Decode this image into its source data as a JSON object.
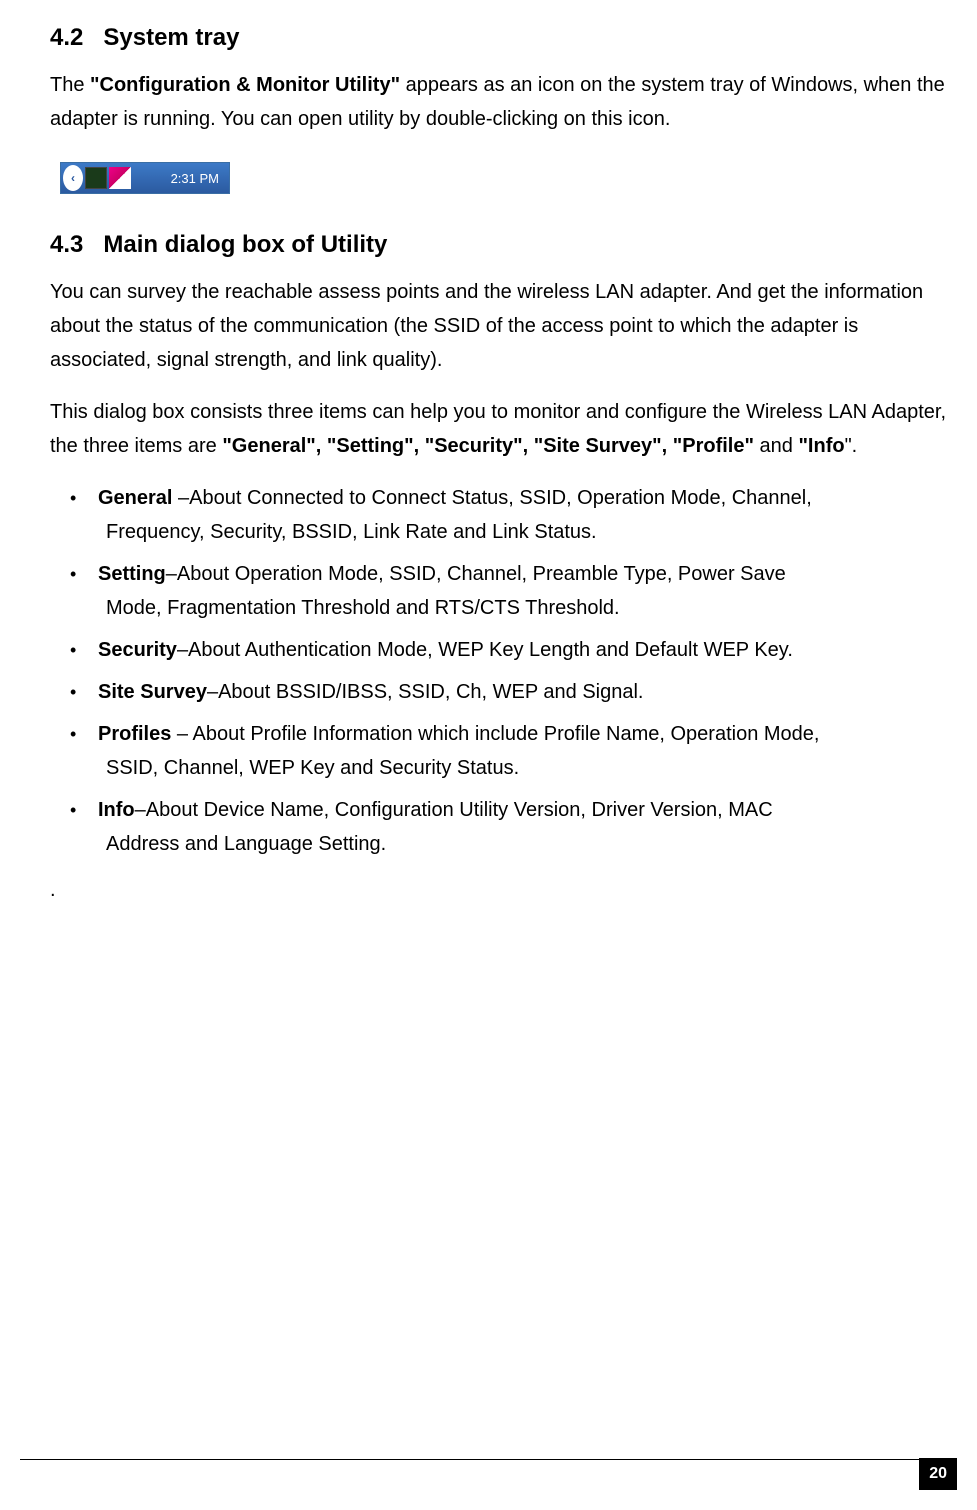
{
  "section1": {
    "number": "4.2",
    "title": "System tray"
  },
  "para1": {
    "pre": "The ",
    "bold": "\"Configuration & Monitor Utility\"",
    "post": " appears as an icon on the system tray of Windows, when the adapter is running. You can open utility by double-clicking on this icon."
  },
  "systray": {
    "time": "2:31 PM"
  },
  "section2": {
    "number": "4.3",
    "title": "Main dialog box of Utility"
  },
  "para2": "You can survey the reachable assess points and the wireless LAN adapter. And get the information about the status of the communication (the SSID of the access point to which the adapter is associated, signal strength, and link quality).",
  "para3": {
    "pre": "This dialog box consists three items can help you to monitor and configure the Wireless LAN Adapter, the three items are ",
    "bold1": "\"General\", \"Setting\", \"Security\", \"Site Survey\", \"Profile\"",
    "mid": " and ",
    "bold2": "\"Info",
    "post": "\"."
  },
  "bullets": [
    {
      "bold": "General ",
      "line1": "–About Connected to Connect Status, SSID, Operation Mode, Channel,",
      "line2": "Frequency, Security, BSSID, Link Rate and Link Status."
    },
    {
      "bold": "Setting",
      "line1": "–About Operation Mode, SSID, Channel, Preamble Type, Power Save",
      "line2": "Mode, Fragmentation Threshold and RTS/CTS Threshold."
    },
    {
      "bold": "Security",
      "line1": "–About Authentication Mode, WEP Key Length and Default WEP Key.",
      "line2": ""
    },
    {
      "bold": "Site Survey",
      "line1": "–About BSSID/IBSS, SSID, Ch, WEP and Signal.",
      "line2": ""
    },
    {
      "bold": "Profiles",
      "line1": " – About Profile Information which include Profile Name, Operation Mode,",
      "line2": "SSID, Channel, WEP Key and Security Status."
    },
    {
      "bold": "Info",
      "line1": "–About Device Name, Configuration Utility Version, Driver Version, MAC",
      "line2": "Address and Language Setting."
    }
  ],
  "trailing_dot": ".",
  "page_number": "20"
}
